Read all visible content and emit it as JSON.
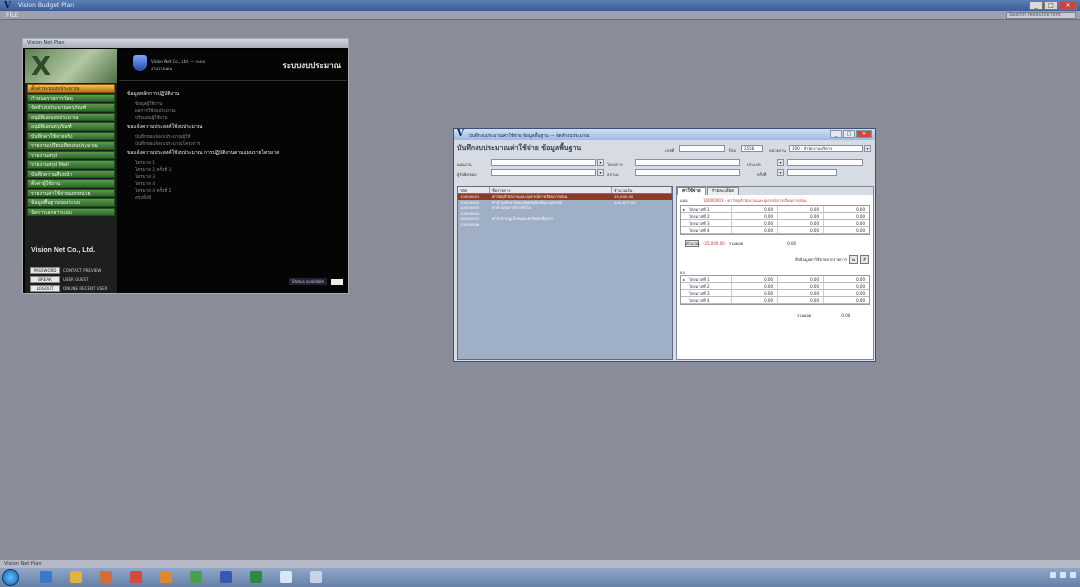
{
  "app": {
    "title": "Vision Budget Plan",
    "menu_file": "FILE",
    "search_placeholder": "Search resource hint"
  },
  "main_window": {
    "title": "Vision Net Plan",
    "menu_items": [
      "ตั้งค่าระบบงบประมาณ",
      "กำหนดรายการวัสดุ",
      "จัดทำงบประมาณครุภัณฑ์",
      "อนุมัติแผนงบประมาณ",
      "อนุมัติแผนครุภัณฑ์",
      "บันทึกค่าใช้จ่ายจริง",
      "รายงานเปรียบเทียบงบประมาณ",
      "รายงานสรุป",
      "รายงานสรุป Mail",
      "บันทึกความคืบหน้า",
      "ตั้งค่าผู้ใช้งาน",
      "รายงานค่าใช้จ่ายแยกหน่วย",
      "ข้อมูลพื้นฐานของระบบ",
      "จัดการเอกสารแนบ"
    ],
    "active_menu_index": 0,
    "company": "Vision Net Co., Ltd.",
    "side_buttons": [
      {
        "label": "PASSWORD",
        "note": "CONTACT PREVIEW"
      },
      {
        "label": "BREAK",
        "note": "USER GUEST"
      },
      {
        "label": "LOGOUT",
        "note": "ONLINE RECENT USER"
      }
    ],
    "header_subtitle": "Vision Net Co., Ltd. — ระบบงานวางแผน",
    "system_title": "ระบบงบประมาณ",
    "sections": [
      {
        "title": "ข้อมูลหลักการปฏิบัติงาน",
        "items": [
          "ข้อมูลผู้ใช้งาน",
          "ผลการใช้งบประมาณ",
          "ปรับแผนผู้ใช้งาน"
        ]
      },
      {
        "title": "ขอแจ้งความประสงค์ใช้งบประมาณ",
        "items": [
          "บันทึกขอแจ้งงบประมาณผู้ใช้",
          "บันทึกขอแจ้งงบประมาณโครงการ"
        ]
      },
      {
        "title": "ขอแจ้งความประสงค์ใช้งบประมาณ การปฏิบัติงานตามแผนรายไตรมาส",
        "items": [
          "ไตรมาส 1",
          "ไตรมาส 2 ครั้งที่ 1",
          "ไตรมาส 3",
          "ไตรมาส 4",
          "ไตรมาส 4 ครั้งที่ 2",
          "สรุปทั้งปี"
        ]
      }
    ],
    "footer_label": "Status available"
  },
  "dialog": {
    "title": "บันทึกงบประมาณค่าใช้จ่าย ข้อมูลพื้นฐาน — จัดทำงบประมาณ",
    "heading": "บันทึกงบประมาณค่าใช้จ่าย ข้อมูลพื้นฐาน",
    "fields": {
      "year_label": "ปีงบ",
      "year_value": "2556",
      "doc_label": "เลขที่",
      "doc_value": "",
      "dept_label": "หน่วยงาน",
      "dept_value": "100 - สำนักงานบริหาร",
      "project_label": "โครงการ",
      "project_value": "",
      "plan_label": "แผนงาน",
      "plan_value": "",
      "owner_label": "ผู้รับผิดชอบ",
      "owner_value": "",
      "type_label": "ประเภท",
      "type_value": "",
      "no_label": "ครั้งที่",
      "no_value": "",
      "status_label": "สถานะ",
      "status_value": ""
    },
    "grid": {
      "headers": [
        "รหัส",
        "ชื่อรายการ",
        "จำนวนเงิน"
      ],
      "rows": [
        {
          "code": "10000001",
          "name": "ค่าวัสดุสำนักงานและอุปกรณ์การเรียนการสอน",
          "amount": "25,000.00",
          "selected": true
        },
        {
          "code": "10000002",
          "name": "ค่าบำรุงรักษาซ่อมแซมครุภัณฑ์และอุปกรณ์",
          "amount": "120,677.00",
          "selected": false
        },
        {
          "code": "10000003",
          "name": "ค่าจ้างเหมาบริการทั่วไป",
          "amount": "",
          "selected": false
        },
        {
          "code": "10000004",
          "name": "",
          "amount": "",
          "selected": false
        },
        {
          "code": "10000005",
          "name": "ค่าสาธารณูปโภคและค่าติดต่อสื่อสาร",
          "amount": "",
          "selected": false
        },
        {
          "code": "10000006",
          "name": "",
          "amount": "",
          "selected": false
        }
      ]
    },
    "tabs": [
      "ค่าใช้จ่าย",
      "รายละเอียด"
    ],
    "upper_section_label": "แผน",
    "red_note": "10000001 - ค่าวัสดุสำนักงานและอุปกรณ์การเรียนการสอน",
    "upper_rows": [
      {
        "label": "ไตรมาสที่ 1",
        "v1": "0.00",
        "v2": "0.00",
        "v3": "0.00"
      },
      {
        "label": "ไตรมาสที่ 2",
        "v1": "0.00",
        "v2": "0.00",
        "v3": "0.00"
      },
      {
        "label": "ไตรมาสที่ 3",
        "v1": "0.00",
        "v2": "0.00",
        "v3": "0.00"
      },
      {
        "label": "ไตรมาสที่ 4",
        "v1": "0.00",
        "v2": "0.00",
        "v3": "0.00"
      }
    ],
    "calc_button": "คำนวณ",
    "calc_value": "-25,000.00",
    "calc_total_label": "รวมยอด",
    "calc_total": "0.00",
    "tool_label": "ดึงข้อมูลค่าใช้จ่ายจากรายการ",
    "lower_section_label": "ผล",
    "lower_rows": [
      {
        "label": "ไตรมาสที่ 1",
        "v1": "0.00",
        "v2": "0.00",
        "v3": "0.00"
      },
      {
        "label": "ไตรมาสที่ 2",
        "v1": "0.00",
        "v2": "0.00",
        "v3": "0.00"
      },
      {
        "label": "ไตรมาสที่ 3",
        "v1": "0.00",
        "v2": "0.00",
        "v3": "0.00"
      },
      {
        "label": "ไตรมาสที่ 4",
        "v1": "0.00",
        "v2": "0.00",
        "v3": "0.00"
      }
    ],
    "lower_total_label": "รวมยอด",
    "lower_total": "0.00"
  },
  "statusbar": {
    "text": "Vision Net Plan"
  },
  "colors": {
    "desktop": "#8a8c99",
    "menu_green": "#3f7f38",
    "menu_active": "#e0a23c",
    "selection": "#8b3c25"
  }
}
